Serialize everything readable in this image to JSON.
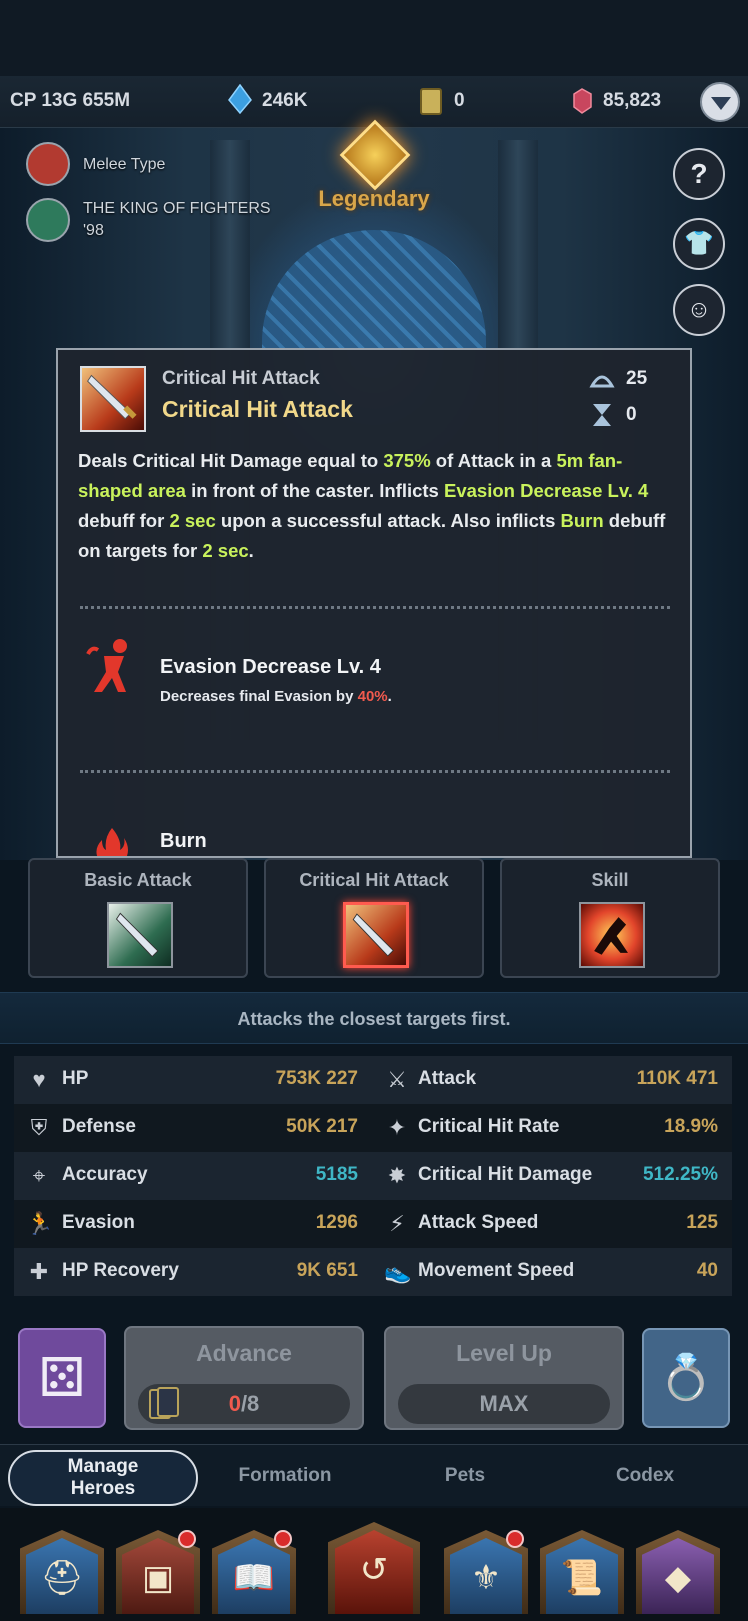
{
  "currency": {
    "cp": "CP 13G 655M",
    "crystals": "246K",
    "cards": "0",
    "gems": "85,823"
  },
  "hero": {
    "type_label": "Melee Type",
    "series_label_line1": "THE KING OF FIGHTERS",
    "series_label_line2": "'98",
    "rarity": "Legendary"
  },
  "side_buttons": {
    "help_label": "?"
  },
  "popup": {
    "subtitle": "Critical Hit Attack",
    "title": "Critical Hit Attack",
    "cooldown": "25",
    "duration": "0",
    "desc": {
      "p1": "Deals Critical Hit Damage equal to ",
      "v1": "375%",
      "p2": " of Attack in a ",
      "v2": "5m fan-shaped area",
      "p3": " in front of the caster. Inflicts ",
      "v3": "Evasion Decrease Lv. 4",
      "p4": " debuff for ",
      "v4": "2 sec",
      "p5": " upon a successful attack. Also inflicts ",
      "v5": "Burn",
      "p6": " debuff on targets for ",
      "v6": "2 sec",
      "p7": "."
    },
    "effects": [
      {
        "title": "Evasion Decrease Lv. 4",
        "desc_prefix": "Decreases final Evasion by ",
        "desc_value": "40%",
        "desc_suffix": "."
      },
      {
        "title": "Burn"
      }
    ]
  },
  "attack_tabs": [
    {
      "label": "Basic Attack"
    },
    {
      "label": "Critical Hit Attack"
    },
    {
      "label": "Skill"
    }
  ],
  "hint": "Attacks the closest targets first.",
  "stats": {
    "left": [
      {
        "name": "HP",
        "value": "753K 227"
      },
      {
        "name": "Defense",
        "value": "50K 217"
      },
      {
        "name": "Accuracy",
        "value": "5185"
      },
      {
        "name": "Evasion",
        "value": "1296"
      },
      {
        "name": "HP Recovery",
        "value": "9K 651"
      }
    ],
    "right": [
      {
        "name": "Attack",
        "value": "110K 471"
      },
      {
        "name": "Critical Hit Rate",
        "value": "18.9%"
      },
      {
        "name": "Critical Hit Damage",
        "value": "512.25%"
      },
      {
        "name": "Attack Speed",
        "value": "125"
      },
      {
        "name": "Movement Speed",
        "value": "40"
      }
    ]
  },
  "actions": {
    "advance_title": "Advance",
    "advance_current": "0",
    "advance_total": "/8",
    "levelup_title": "Level Up",
    "levelup_value": "MAX"
  },
  "tabs": {
    "manage_line1": "Manage",
    "manage_line2": "Heroes",
    "formation": "Formation",
    "pets": "Pets",
    "codex": "Codex"
  },
  "colors": {
    "highlight": "#c9f25c",
    "stat_value": "#c8a45a",
    "stat_value_cyan": "#3fb7c6",
    "rarity": "#d9a64a",
    "debuff_red": "#f05a4e"
  }
}
